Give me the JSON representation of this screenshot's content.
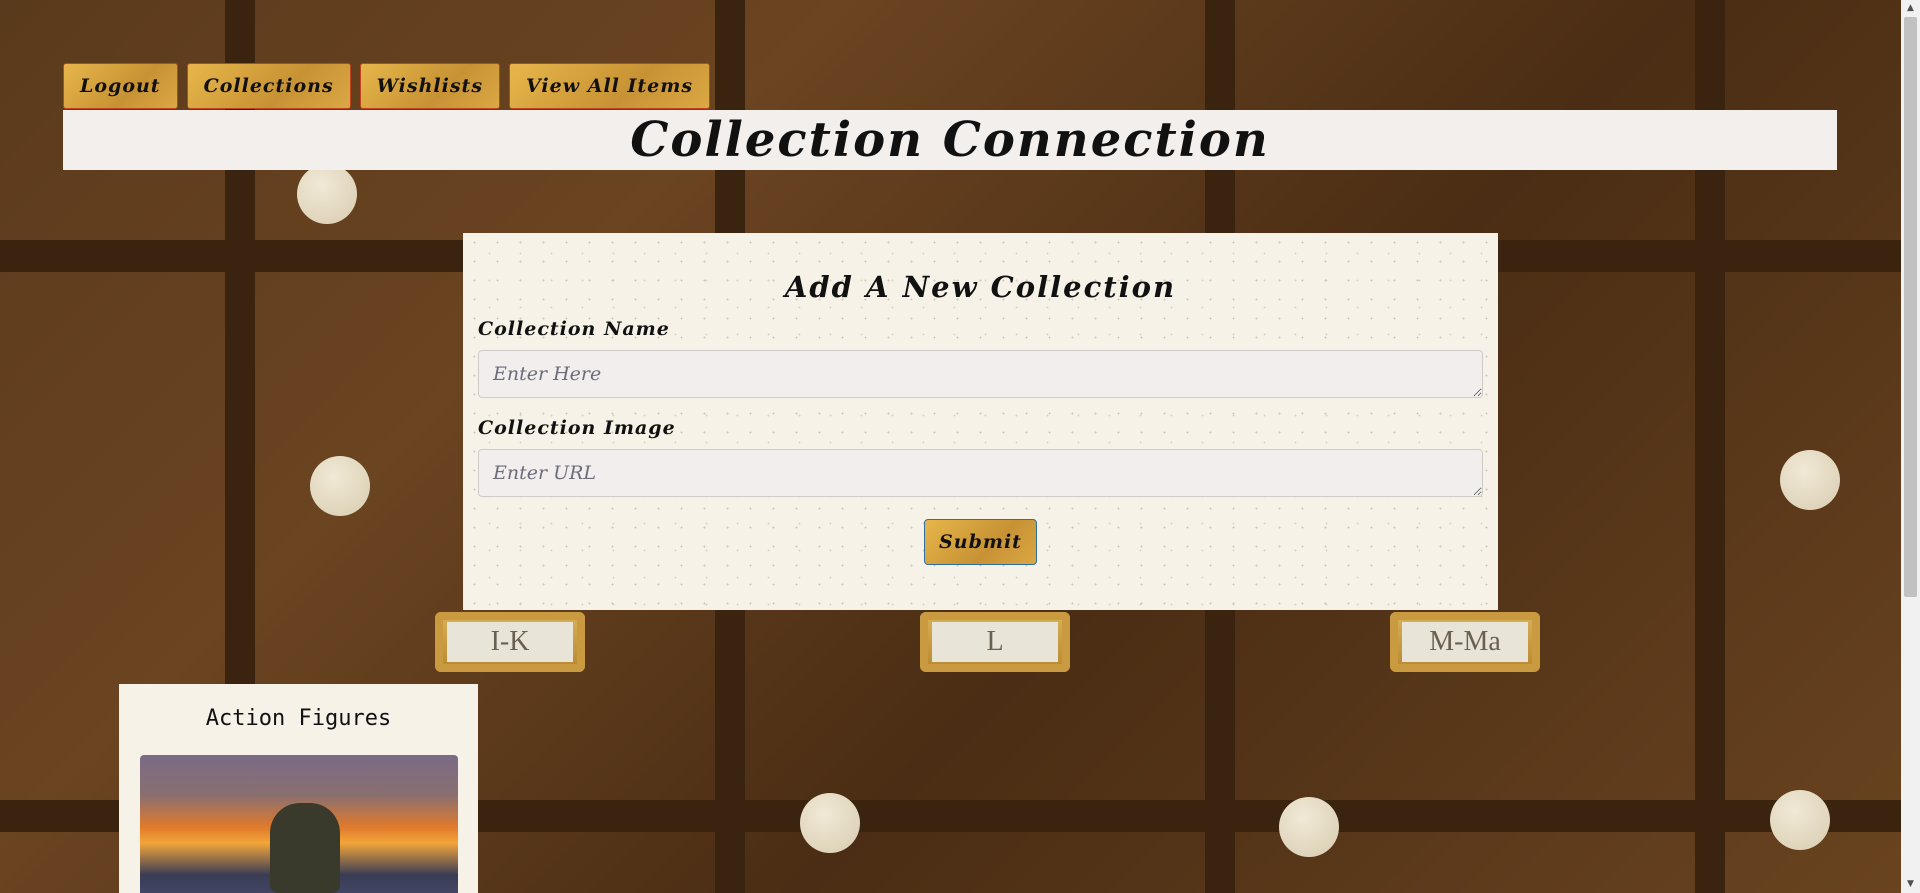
{
  "nav": {
    "logout": "Logout",
    "collections": "Collections",
    "wishlists": "Wishlists",
    "view_all": "View All Items"
  },
  "site_title": "Collection Connection",
  "form": {
    "heading": "Add A New Collection",
    "name_label": "Collection Name",
    "name_placeholder": "Enter Here",
    "image_label": "Collection Image",
    "image_placeholder": "Enter URL",
    "submit": "Submit"
  },
  "collections": [
    {
      "title": "Action Figures"
    }
  ],
  "background": {
    "drawer_labels": [
      "I-K",
      "L",
      "M-Ma"
    ]
  },
  "colors": {
    "button_gold": "#d9a642",
    "button_border": "#c0441f",
    "submit_border": "#2f6ea5",
    "panel": "#f6f2e7",
    "title_bar": "#f2efec"
  }
}
